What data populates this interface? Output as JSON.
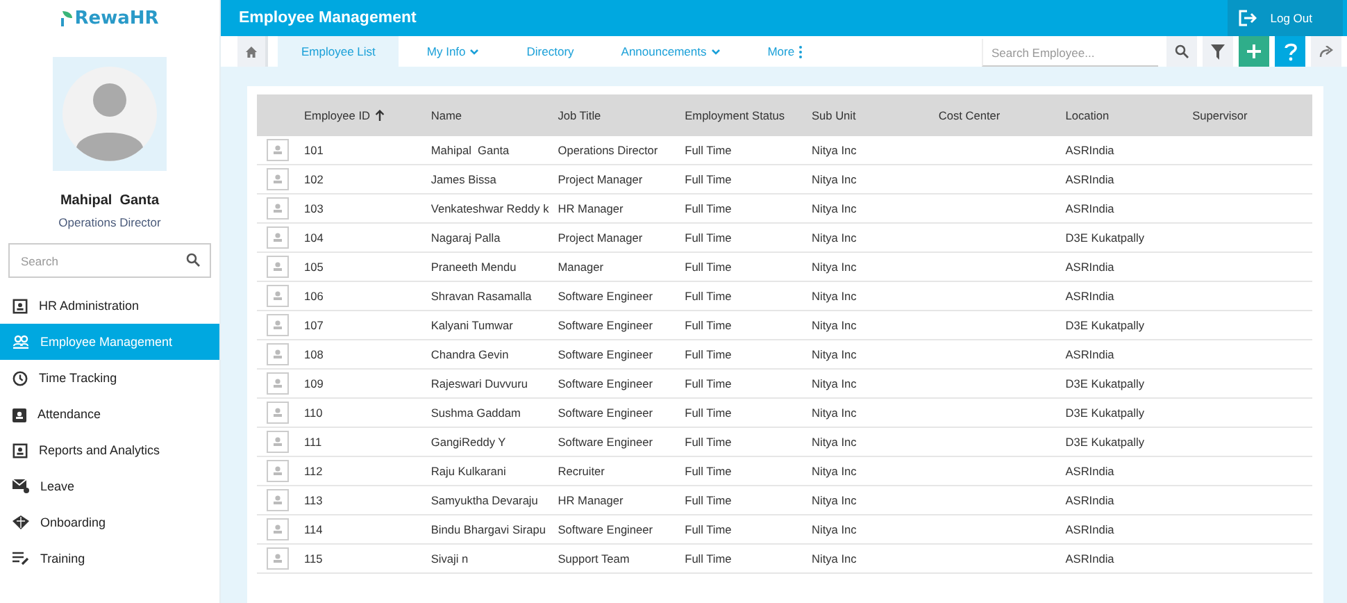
{
  "app": {
    "logo": "RewaHR"
  },
  "profile": {
    "name": "Mahipal  Ganta",
    "title": "Operations Director"
  },
  "sidebar": {
    "search": {
      "placeholder": "Search"
    },
    "items": [
      {
        "label": "HR Administration",
        "selected": false
      },
      {
        "label": "Employee Management",
        "selected": true
      },
      {
        "label": "Time Tracking",
        "selected": false
      },
      {
        "label": "Attendance",
        "selected": false
      },
      {
        "label": "Reports and Analytics",
        "selected": false
      },
      {
        "label": "Leave",
        "selected": false
      },
      {
        "label": "Onboarding",
        "selected": false
      },
      {
        "label": "Training",
        "selected": false
      }
    ]
  },
  "header": {
    "title": "Employee Management",
    "logout": "Log Out"
  },
  "tabs": [
    {
      "label": "Employee List",
      "selected": true,
      "kind": "plain"
    },
    {
      "label": "My Info",
      "selected": false,
      "kind": "dropdown"
    },
    {
      "label": "Directory",
      "selected": false,
      "kind": "plain"
    },
    {
      "label": "Announcements",
      "selected": false,
      "kind": "dropdown"
    },
    {
      "label": "More",
      "selected": false,
      "kind": "more"
    }
  ],
  "employee_search": {
    "placeholder": "Search Employee..."
  },
  "table": {
    "columns": [
      {
        "label": "Employee ID",
        "sorted_ascending": true
      },
      {
        "label": "Name",
        "sorted_ascending": false
      },
      {
        "label": "Job Title",
        "sorted_ascending": false
      },
      {
        "label": "Employment Status",
        "sorted_ascending": false
      },
      {
        "label": "Sub Unit",
        "sorted_ascending": false
      },
      {
        "label": "Cost Center",
        "sorted_ascending": false
      },
      {
        "label": "Location",
        "sorted_ascending": false
      },
      {
        "label": "Supervisor",
        "sorted_ascending": false
      }
    ],
    "rows": [
      {
        "id": "101",
        "name": "Mahipal  Ganta",
        "job_title": "Operations Director",
        "employment_status": "Full Time",
        "sub_unit": "Nitya Inc",
        "location": "ASRIndia"
      },
      {
        "id": "102",
        "name": "James Bissa",
        "job_title": "Project Manager",
        "employment_status": "Full Time",
        "sub_unit": "Nitya Inc",
        "location": "ASRIndia"
      },
      {
        "id": "103",
        "name": "Venkateshwar Reddy k",
        "job_title": "HR Manager",
        "employment_status": "Full Time",
        "sub_unit": "Nitya Inc",
        "location": "ASRIndia"
      },
      {
        "id": "104",
        "name": "Nagaraj Palla",
        "job_title": "Project Manager",
        "employment_status": "Full Time",
        "sub_unit": "Nitya Inc",
        "location": "D3E Kukatpally"
      },
      {
        "id": "105",
        "name": "Praneeth Mendu",
        "job_title": "Manager",
        "employment_status": "Full Time",
        "sub_unit": "Nitya Inc",
        "location": "ASRIndia"
      },
      {
        "id": "106",
        "name": "Shravan Rasamalla",
        "job_title": "Software Engineer",
        "employment_status": "Full Time",
        "sub_unit": "Nitya Inc",
        "location": "ASRIndia"
      },
      {
        "id": "107",
        "name": "Kalyani Tumwar",
        "job_title": "Software Engineer",
        "employment_status": "Full Time",
        "sub_unit": "Nitya Inc",
        "location": "D3E Kukatpally"
      },
      {
        "id": "108",
        "name": "Chandra Gevin",
        "job_title": "Software Engineer",
        "employment_status": "Full Time",
        "sub_unit": "Nitya Inc",
        "location": "ASRIndia"
      },
      {
        "id": "109",
        "name": "Rajeswari Duvvuru",
        "job_title": "Software Engineer",
        "employment_status": "Full Time",
        "sub_unit": "Nitya Inc",
        "location": "D3E Kukatpally"
      },
      {
        "id": "110",
        "name": "Sushma Gaddam",
        "job_title": "Software Engineer",
        "employment_status": "Full Time",
        "sub_unit": "Nitya Inc",
        "location": "D3E Kukatpally"
      },
      {
        "id": "111",
        "name": "GangiReddy Y",
        "job_title": "Software Engineer",
        "employment_status": "Full Time",
        "sub_unit": "Nitya Inc",
        "location": "D3E Kukatpally"
      },
      {
        "id": "112",
        "name": "Raju Kulkarani",
        "job_title": "Recruiter",
        "employment_status": "Full Time",
        "sub_unit": "Nitya Inc",
        "location": "ASRIndia"
      },
      {
        "id": "113",
        "name": "Samyuktha Devaraju",
        "job_title": "HR Manager",
        "employment_status": "Full Time",
        "sub_unit": "Nitya Inc",
        "location": "ASRIndia"
      },
      {
        "id": "114",
        "name": "Bindu Bhargavi Sirapu",
        "job_title": "Software Engineer",
        "employment_status": "Full Time",
        "sub_unit": "Nitya Inc",
        "location": "ASRIndia"
      },
      {
        "id": "115",
        "name": "Sivaji n",
        "job_title": "Support Team",
        "employment_status": "Full Time",
        "sub_unit": "Nitya Inc",
        "location": "ASRIndia"
      }
    ]
  }
}
